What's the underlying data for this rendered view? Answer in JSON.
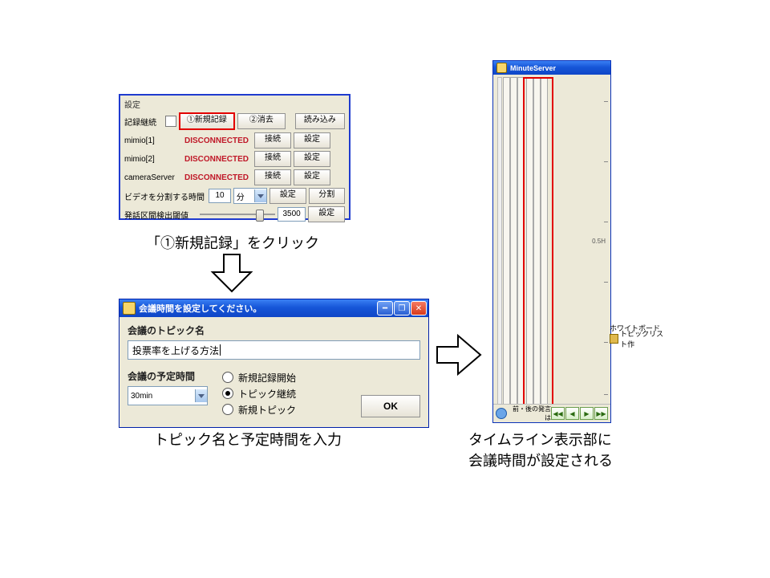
{
  "panel1": {
    "section_label": "設定",
    "record_cont_label": "記録継続",
    "new_record": "①新規記録",
    "clear": "②消去",
    "read": "読み込み",
    "devices": [
      {
        "name": "mimio[1]",
        "status": "DISCONNECTED",
        "connect": "接続",
        "config": "設定"
      },
      {
        "name": "mimio[2]",
        "status": "DISCONNECTED",
        "connect": "接続",
        "config": "設定"
      },
      {
        "name": "cameraServer",
        "status": "DISCONNECTED",
        "connect": "接続",
        "config": "設定"
      }
    ],
    "video_split_label": "ビデオを分割する時間",
    "video_split_value": "10",
    "video_split_unit": "分",
    "video_split_set": "設定",
    "video_split_btn": "分割",
    "threshold_label": "発話区間検出閾値",
    "threshold_value": "3500",
    "threshold_set": "設定"
  },
  "captions": {
    "c1": "「①新規記録」をクリック",
    "c2": "トピック名と予定時間を入力",
    "c3": "タイムライン表示部に\n会議時間が設定される"
  },
  "dialog": {
    "title": "会議時間を設定してください。",
    "topic_label": "会議のトピック名",
    "topic_value": "投票率を上げる方法",
    "duration_label": "会議の予定時間",
    "duration_value": "30min",
    "radios": {
      "r1": "新規記録開始",
      "r2": "トピック継続",
      "r3": "新規トピック"
    },
    "ok": "OK"
  },
  "timeline": {
    "title": "MinuteServer",
    "tick_label": "0.5H",
    "side1": "ホワイトボード",
    "side2": "トピックリスト作",
    "bottom_label": "前・後の発言は",
    "play": {
      "b1": "◀◀",
      "b2": "◀",
      "b3": "▶",
      "b4": "▶▶"
    }
  }
}
